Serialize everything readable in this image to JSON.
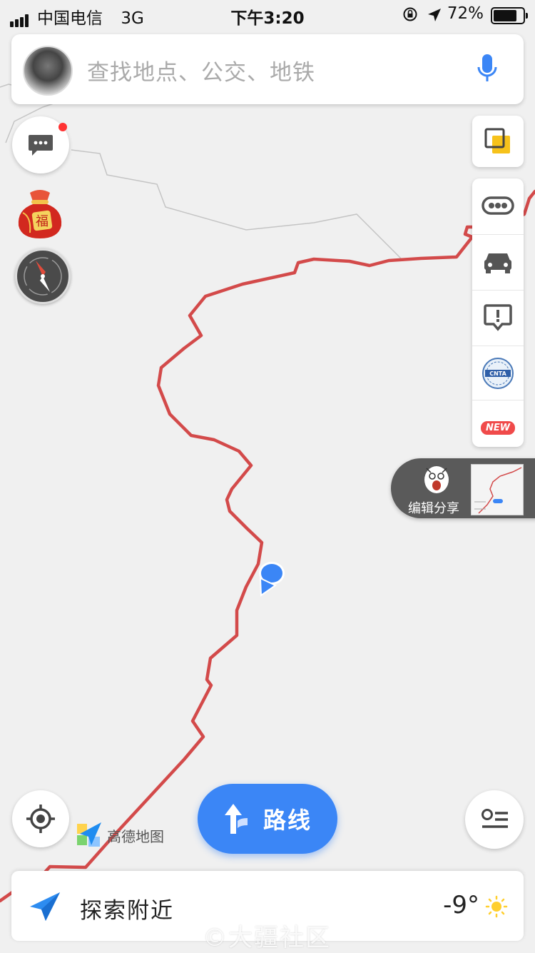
{
  "status": {
    "carrier": "中国电信",
    "network": "3G",
    "time": "下午3:20",
    "battery_pct": "72%",
    "battery_level": 0.72
  },
  "search": {
    "placeholder": "查找地点、公交、地铁"
  },
  "map": {
    "route_color": "#d34a4a",
    "boundary_color": "#bdbdbd",
    "marker_color": "#3b86f6"
  },
  "toolbar": {
    "new_badge": "NEW",
    "cnta_badge": "CNTA"
  },
  "share": {
    "label": "编辑分享"
  },
  "footer": {
    "brand": "高德地图",
    "route_label": "路线",
    "explore_label": "探索附近",
    "temperature": "-9°"
  },
  "watermark": "©大疆社区",
  "colors": {
    "accent": "#3b86f6",
    "notification": "#f33333",
    "new_badge": "#f04a4a"
  }
}
